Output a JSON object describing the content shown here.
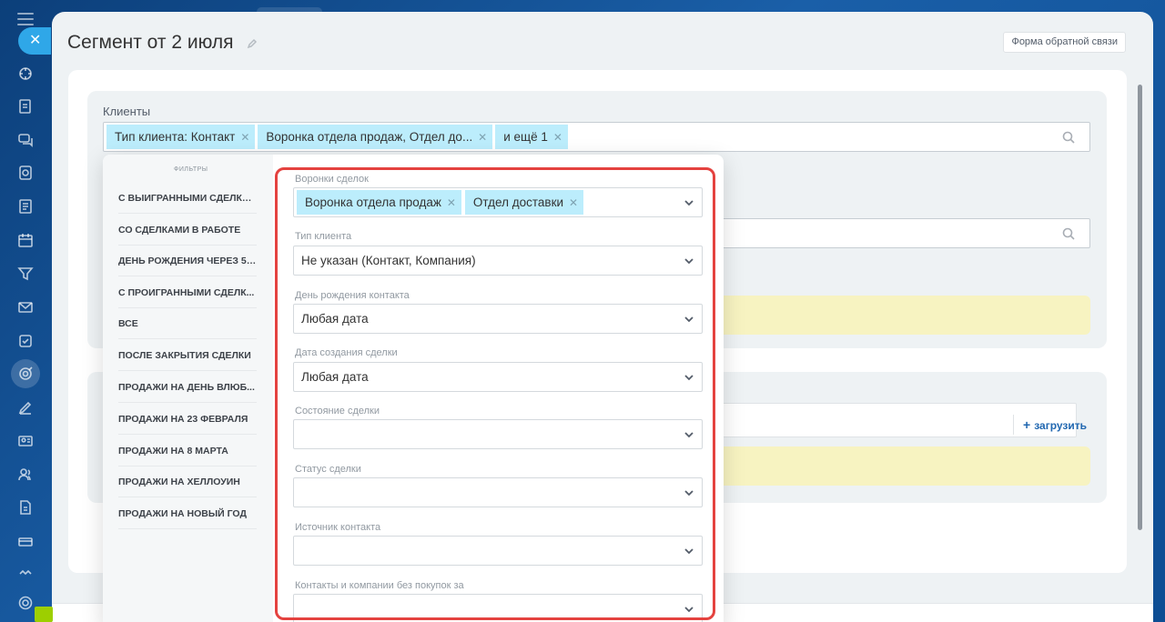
{
  "page_title": "Сегмент от 2 июля",
  "feedback_button": "Форма обратной связи",
  "clients_section": {
    "label": "Клиенты",
    "tags": [
      {
        "label": "Тип клиента: Контакт"
      },
      {
        "label": "Воронка отдела продаж, Отдел до..."
      },
      {
        "label": "и ещё 1"
      }
    ]
  },
  "upload_button": "загрузить",
  "filter_popup": {
    "presets_title": "ФИЛЬТРЫ",
    "presets": [
      "С ВЫИГРАННЫМИ СДЕЛКА...",
      "СО СДЕЛКАМИ В РАБОТЕ",
      "ДЕНЬ РОЖДЕНИЯ ЧЕРЕЗ 5 ...",
      "С ПРОИГРАННЫМИ СДЕЛК...",
      "ВСЕ",
      "ПОСЛЕ ЗАКРЫТИЯ СДЕЛКИ",
      "ПРОДАЖИ НА ДЕНЬ ВЛЮБ...",
      "ПРОДАЖИ НА 23 ФЕВРАЛЯ",
      "ПРОДАЖИ НА 8 МАРТА",
      "ПРОДАЖИ НА ХЕЛЛОУИН",
      "ПРОДАЖИ НА НОВЫЙ ГОД"
    ],
    "fields": {
      "funnels": {
        "label": "Воронки сделок",
        "tags": [
          "Воронка отдела продаж",
          "Отдел доставки"
        ]
      },
      "client_type": {
        "label": "Тип клиента",
        "value": "Не указан (Контакт, Компания)"
      },
      "birthday": {
        "label": "День рождения контакта",
        "value": "Любая дата"
      },
      "deal_created": {
        "label": "Дата создания сделки",
        "value": "Любая дата"
      },
      "deal_state": {
        "label": "Состояние сделки",
        "value": ""
      },
      "deal_status": {
        "label": "Статус сделки",
        "value": ""
      },
      "contact_source": {
        "label": "Источник контакта",
        "value": ""
      },
      "no_purchases": {
        "label": "Контакты и компании без покупок за",
        "value": ""
      }
    }
  },
  "colors": {
    "tag_bg": "#bcedfc",
    "highlight": "#e4423f",
    "close_button": "#2fa7e8",
    "yellow_notice": "#f7f3c1"
  }
}
